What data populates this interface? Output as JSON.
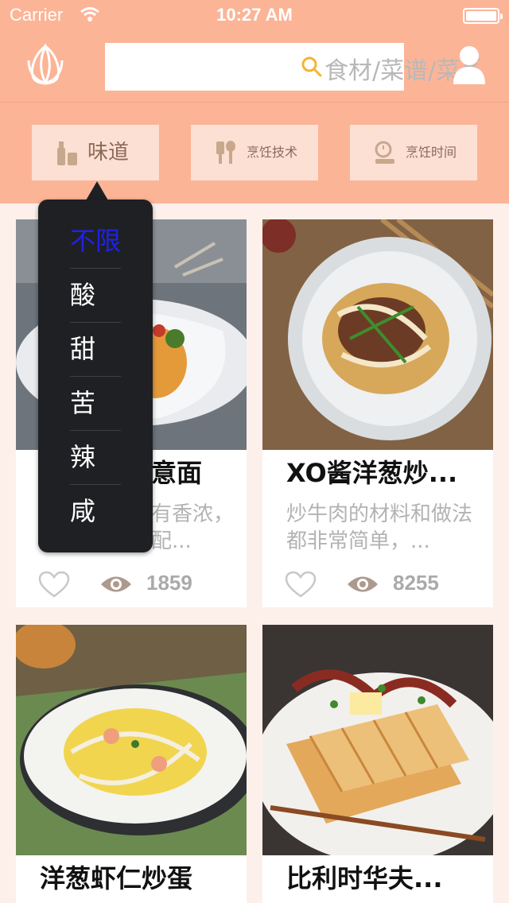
{
  "status_bar": {
    "carrier": "Carrier",
    "time": "10:27 AM"
  },
  "nav": {
    "search_placeholder": "食材/菜谱/菜系",
    "icons": {
      "logo": "tulip-logo-icon",
      "search": "search-icon",
      "user": "user-profile-icon"
    }
  },
  "filters": [
    {
      "label": "味道",
      "icon": "seasoning-bottle-icon"
    },
    {
      "label": "烹饪技术",
      "icon": "cooking-utensils-icon"
    },
    {
      "label": "烹饪时间",
      "icon": "timer-clock-icon"
    }
  ],
  "taste_menu": {
    "selected": "不限",
    "options": [
      "不限",
      "酸",
      "甜",
      "苦",
      "辣",
      "咸"
    ]
  },
  "recipes": [
    {
      "title": "意面",
      "description": "有香浓，配...",
      "views": "1859",
      "photo": "pasta-in-parchment"
    },
    {
      "title": "XO酱洋葱炒...",
      "description": "炒牛肉的材料和做法都非常简单，...",
      "views": "8255",
      "photo": "beef-onion-stirfry"
    },
    {
      "title": "洋葱虾仁炒蛋",
      "description": "",
      "views": "",
      "photo": "shrimp-egg-onion"
    },
    {
      "title": "比利时华夫...",
      "description": "",
      "views": "",
      "photo": "belgian-waffle-bacon"
    }
  ],
  "colors": {
    "accent": "#fcb497",
    "accent_light": "#fde0d4",
    "popup_bg": "#1f2023",
    "selected": "#1f22e6"
  }
}
